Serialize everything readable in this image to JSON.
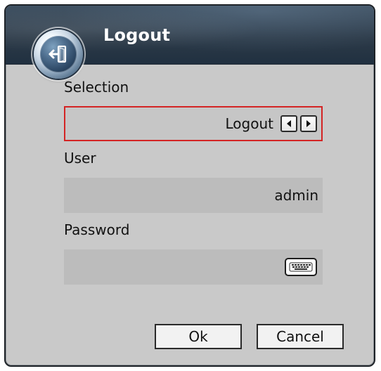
{
  "dialog": {
    "title": "Logout",
    "icon": "logout-icon"
  },
  "form": {
    "selection": {
      "label": "Selection",
      "value": "Logout",
      "prev_icon": "arrow-left-icon",
      "next_icon": "arrow-right-icon",
      "highlight_color": "#d42424"
    },
    "user": {
      "label": "User",
      "value": "admin"
    },
    "password": {
      "label": "Password",
      "value": "",
      "keyboard_icon": "keyboard-icon"
    }
  },
  "buttons": {
    "ok_label": "Ok",
    "cancel_label": "Cancel"
  }
}
